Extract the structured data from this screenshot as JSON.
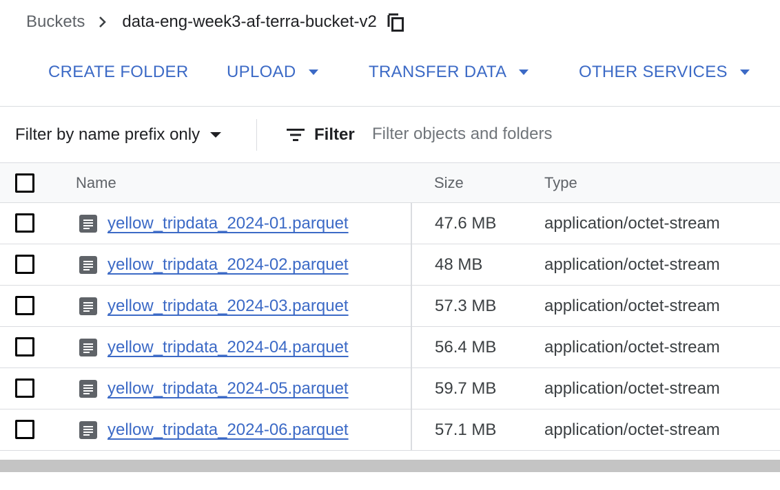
{
  "breadcrumb": {
    "root": "Buckets",
    "separator_icon": "chevron-right-icon",
    "current": "data-eng-week3-af-terra-bucket-v2",
    "copy_icon": "copy-icon"
  },
  "toolbar": {
    "create_folder": "CREATE FOLDER",
    "upload": "UPLOAD",
    "transfer_data": "TRANSFER DATA",
    "other_services": "OTHER SERVICES"
  },
  "filter": {
    "mode": "Filter by name prefix only",
    "button": "Filter",
    "placeholder": "Filter objects and folders"
  },
  "table": {
    "columns": {
      "name": "Name",
      "size": "Size",
      "type": "Type"
    },
    "rows": [
      {
        "name": "yellow_tripdata_2024-01.parquet",
        "size": "47.6 MB",
        "type": "application/octet-stream"
      },
      {
        "name": "yellow_tripdata_2024-02.parquet",
        "size": "48 MB",
        "type": "application/octet-stream"
      },
      {
        "name": "yellow_tripdata_2024-03.parquet",
        "size": "57.3 MB",
        "type": "application/octet-stream"
      },
      {
        "name": "yellow_tripdata_2024-04.parquet",
        "size": "56.4 MB",
        "type": "application/octet-stream"
      },
      {
        "name": "yellow_tripdata_2024-05.parquet",
        "size": "59.7 MB",
        "type": "application/octet-stream"
      },
      {
        "name": "yellow_tripdata_2024-06.parquet",
        "size": "57.1 MB",
        "type": "application/octet-stream"
      }
    ]
  },
  "colors": {
    "link": "#3c6ac6",
    "text": "#202124",
    "muted": "#5f6368",
    "divider": "#dadce0"
  }
}
